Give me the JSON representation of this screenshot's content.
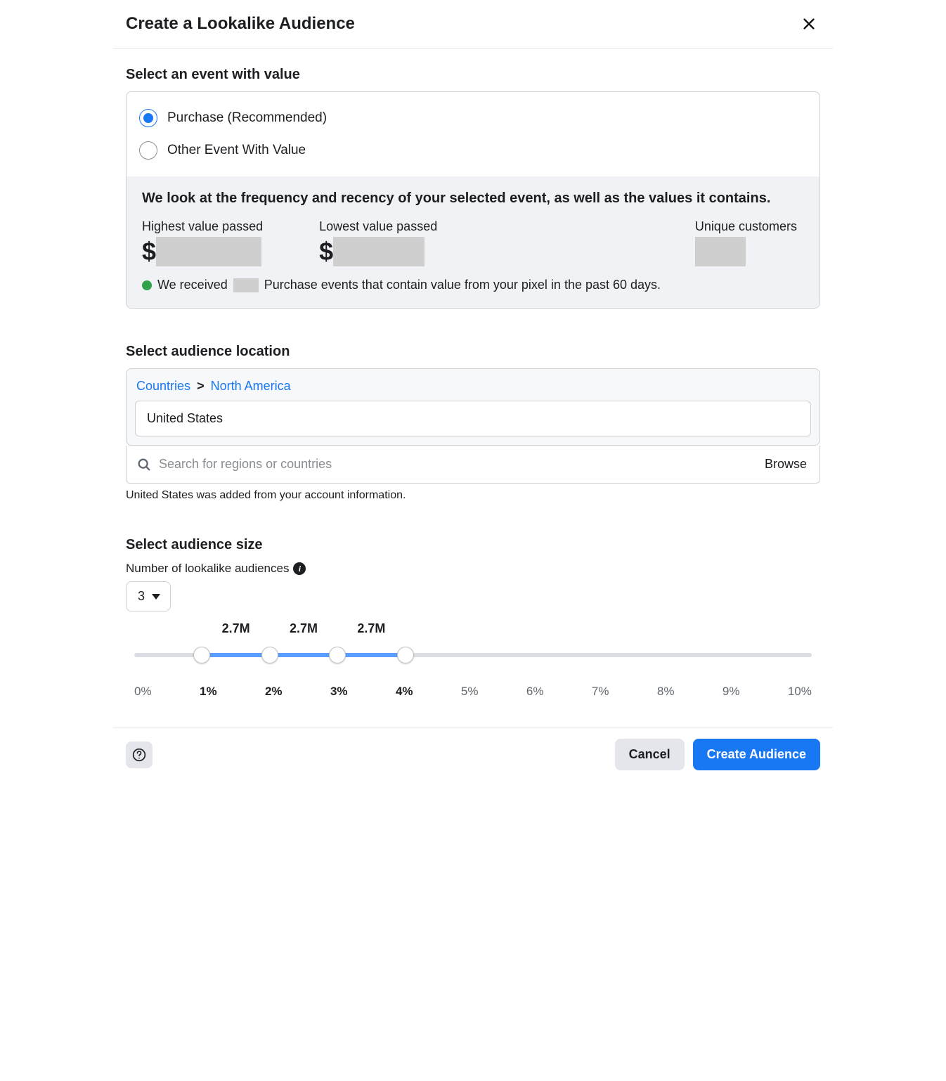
{
  "dialog": {
    "title": "Create a Lookalike Audience"
  },
  "events": {
    "heading": "Select an event with value",
    "options": [
      {
        "label": "Purchase (Recommended)",
        "selected": true
      },
      {
        "label": "Other Event With Value",
        "selected": false
      }
    ],
    "info_heading": "We look at the frequency and recency of your selected event, as well as the values it contains.",
    "stats": {
      "highest_label": "Highest value passed",
      "highest_prefix": "$",
      "lowest_label": "Lowest value passed",
      "lowest_prefix": "$",
      "unique_label": "Unique customers"
    },
    "status_prefix": "We received",
    "status_suffix": "Purchase events that contain value from your pixel in the past 60 days."
  },
  "location": {
    "heading": "Select audience location",
    "breadcrumb": {
      "level1": "Countries",
      "sep": ">",
      "level2": "North America"
    },
    "selected": "United States",
    "search_placeholder": "Search for regions or countries",
    "browse_label": "Browse",
    "hint": "United States was added from your account information."
  },
  "size": {
    "heading": "Select audience size",
    "subheading": "Number of lookalike audiences",
    "count": "3",
    "segment_labels": [
      "2.7M",
      "2.7M",
      "2.7M"
    ],
    "ticks": [
      "0%",
      "1%",
      "2%",
      "3%",
      "4%",
      "5%",
      "6%",
      "7%",
      "8%",
      "9%",
      "10%"
    ],
    "active_ticks": [
      1,
      2,
      3,
      4
    ],
    "handles_percent": [
      10,
      20,
      30,
      40
    ],
    "fill_from_percent": 10,
    "fill_to_percent": 40
  },
  "footer": {
    "cancel": "Cancel",
    "create": "Create Audience",
    "help": "?"
  }
}
